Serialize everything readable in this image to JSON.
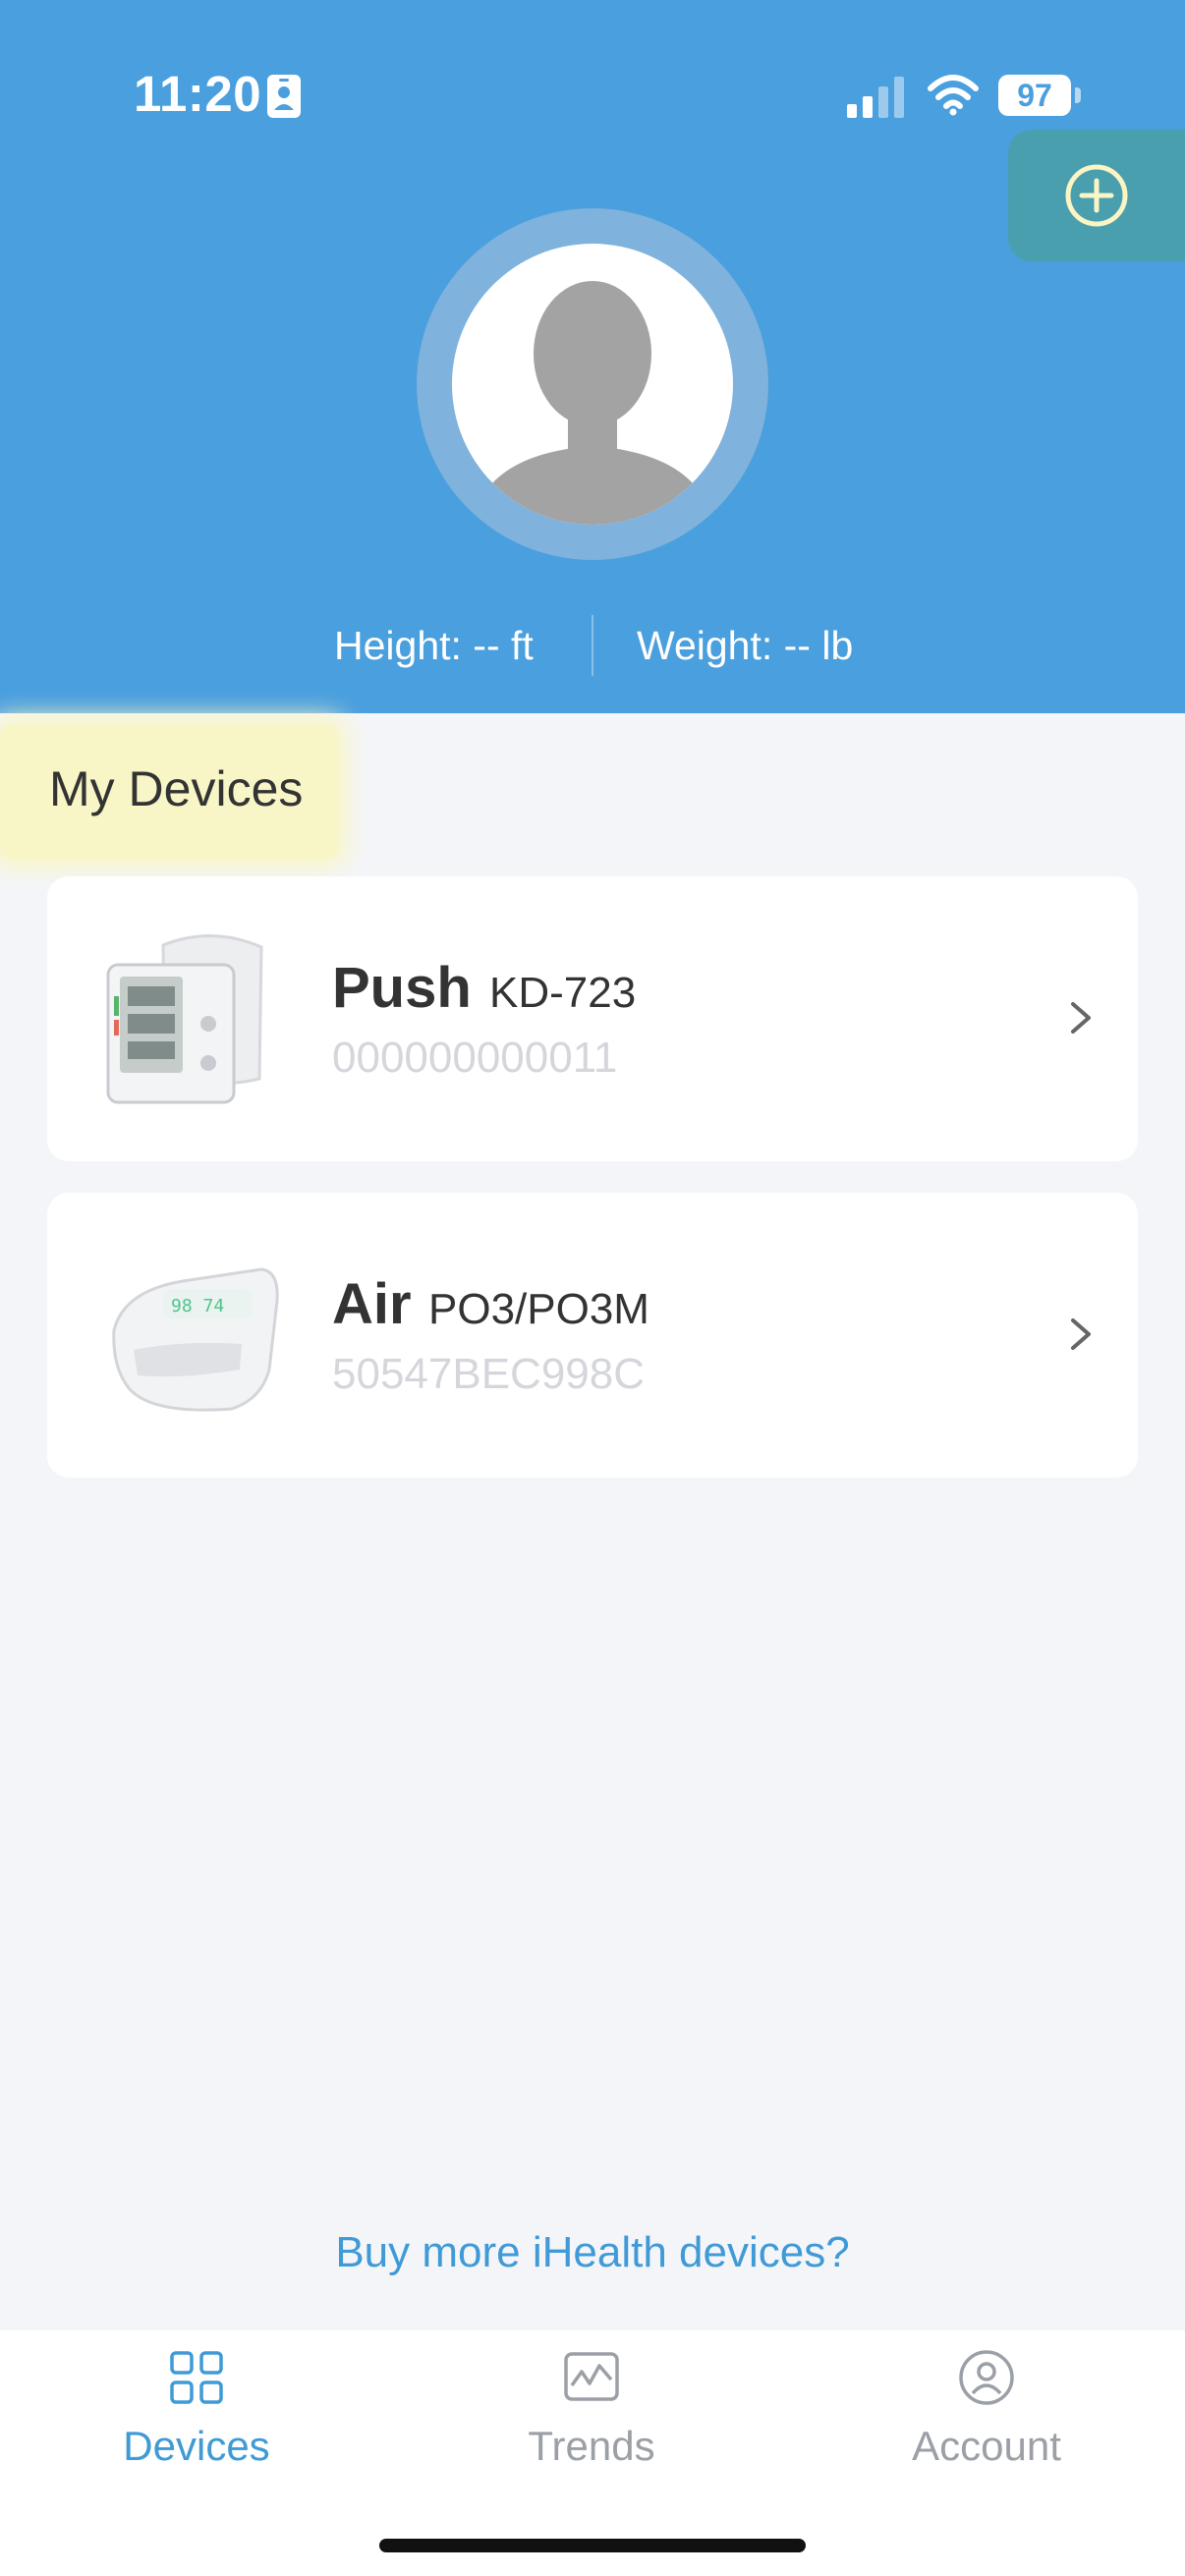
{
  "status_bar": {
    "time": "11:20",
    "battery": "97"
  },
  "header": {
    "height_label": "Height: -- ft",
    "weight_label": "Weight: -- lb"
  },
  "section": {
    "title": "My Devices"
  },
  "devices": [
    {
      "name": "Push",
      "model": "KD-723",
      "serial": "000000000011",
      "icon": "wrist-bp-monitor-image"
    },
    {
      "name": "Air",
      "model": "PO3/PO3M",
      "serial": "50547BEC998C",
      "icon": "pulse-oximeter-image"
    }
  ],
  "buy_link": "Buy more iHealth devices?",
  "nav": [
    {
      "label": "Devices",
      "icon": "grid-icon",
      "active": true
    },
    {
      "label": "Trends",
      "icon": "chart-icon",
      "active": false
    },
    {
      "label": "Account",
      "icon": "user-circle-icon",
      "active": false
    }
  ],
  "colors": {
    "header": "#4a9fde",
    "accent": "#3f9ad6",
    "add_button": "#4a9faf",
    "highlight": "#f8f6c6",
    "background": "#f4f5f9"
  }
}
